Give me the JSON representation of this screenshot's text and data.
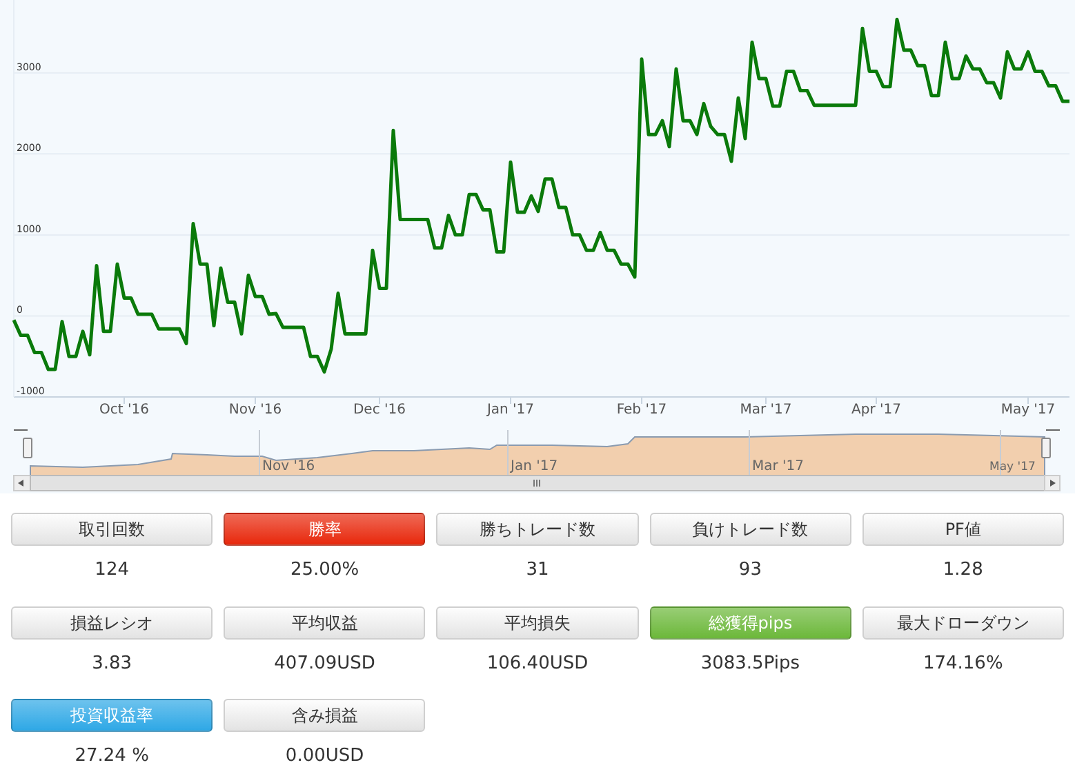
{
  "chart": {
    "chart_data": {
      "type": "line",
      "categories": [
        null,
        null,
        null,
        null,
        null,
        null,
        null,
        null,
        null,
        null,
        null,
        null,
        null,
        null,
        null,
        null,
        "Oct '16",
        null,
        null,
        null,
        null,
        null,
        null,
        null,
        null,
        null,
        null,
        null,
        null,
        null,
        null,
        null,
        null,
        null,
        null,
        "Nov '16",
        null,
        null,
        null,
        null,
        null,
        null,
        null,
        null,
        null,
        null,
        null,
        null,
        null,
        null,
        null,
        null,
        null,
        "Dec '16",
        null,
        null,
        null,
        null,
        null,
        null,
        null,
        null,
        null,
        null,
        null,
        null,
        null,
        null,
        null,
        null,
        null,
        null,
        "Jan '17",
        null,
        null,
        null,
        null,
        null,
        null,
        null,
        null,
        null,
        null,
        null,
        null,
        null,
        null,
        null,
        null,
        null,
        null,
        "Feb '17",
        null,
        null,
        null,
        null,
        null,
        null,
        null,
        null,
        null,
        null,
        null,
        null,
        null,
        null,
        null,
        null,
        null,
        "Mar '17",
        null,
        null,
        null,
        null,
        null,
        null,
        null,
        null,
        null,
        null,
        null,
        null,
        null,
        null,
        null,
        "Apr '17",
        null,
        null,
        null,
        null,
        null,
        null,
        null,
        null,
        null,
        null,
        null,
        null,
        null,
        null,
        null,
        null,
        null,
        null,
        null,
        null,
        null,
        "May '17",
        null,
        null,
        null,
        null,
        null,
        null
      ],
      "series": [
        {
          "color": "#0a7a0a",
          "values": [
            -50,
            -240,
            -240,
            -450,
            -450,
            -660,
            -660,
            -70,
            -500,
            -500,
            -190,
            -480,
            620,
            -190,
            -190,
            640,
            220,
            220,
            20,
            20,
            20,
            -160,
            -160,
            -160,
            -160,
            -340,
            1140,
            640,
            640,
            -120,
            590,
            170,
            170,
            -220,
            500,
            240,
            240,
            20,
            30,
            -140,
            -140,
            -140,
            -140,
            -500,
            -500,
            -690,
            -410,
            280,
            -220,
            -220,
            -220,
            -220,
            810,
            340,
            340,
            2290,
            1190,
            1190,
            1190,
            1190,
            1190,
            840,
            840,
            1240,
            1000,
            1000,
            1500,
            1500,
            1310,
            1310,
            790,
            790,
            1900,
            1280,
            1280,
            1480,
            1290,
            1690,
            1690,
            1340,
            1340,
            1000,
            1000,
            810,
            810,
            1030,
            810,
            810,
            640,
            640,
            480,
            3170,
            2240,
            2240,
            2410,
            2090,
            3050,
            2410,
            2410,
            2240,
            2620,
            2340,
            2240,
            2240,
            1910,
            2690,
            2190,
            3380,
            2930,
            2930,
            2590,
            2590,
            3020,
            3020,
            2780,
            2780,
            2600,
            2600,
            2600,
            2600,
            2600,
            2600,
            2600,
            3550,
            3020,
            3020,
            2830,
            2830,
            3660,
            3280,
            3280,
            3090,
            3090,
            2720,
            2720,
            3380,
            2930,
            2930,
            3210,
            3050,
            3050,
            2880,
            2880,
            2690,
            3260,
            3050,
            3050,
            3260,
            3020,
            3020,
            2840,
            2840,
            2650,
            2650
          ]
        }
      ],
      "ylim": [
        -1000,
        3900
      ],
      "grid": true,
      "yticks": [
        -1000,
        0,
        1000,
        2000,
        3000
      ]
    }
  },
  "navigator": {
    "labels": [
      "Nov '16",
      "Jan '17",
      "Mar '17",
      "May '17"
    ]
  },
  "stats": [
    {
      "label": "取引回数",
      "value": "124"
    },
    {
      "label": "勝率",
      "value": "25.00%",
      "color": "#e8280c"
    },
    {
      "label": "勝ちトレード数",
      "value": "31"
    },
    {
      "label": "負けトレード数",
      "value": "93"
    },
    {
      "label": "PF値",
      "value": "1.28"
    },
    {
      "label": "損益レシオ",
      "value": "3.83"
    },
    {
      "label": "平均収益",
      "value": "407.09USD"
    },
    {
      "label": "平均損失",
      "value": "106.40USD"
    },
    {
      "label": "総獲得pips",
      "value": "3083.5Pips",
      "color": "#6cb83a"
    },
    {
      "label": "最大ドローダウン",
      "value": "174.16%"
    },
    {
      "label": "投資収益率",
      "value": "27.24 %",
      "color": "#2ea8e6"
    },
    {
      "label": "含み損益",
      "value": "0.00USD"
    }
  ]
}
